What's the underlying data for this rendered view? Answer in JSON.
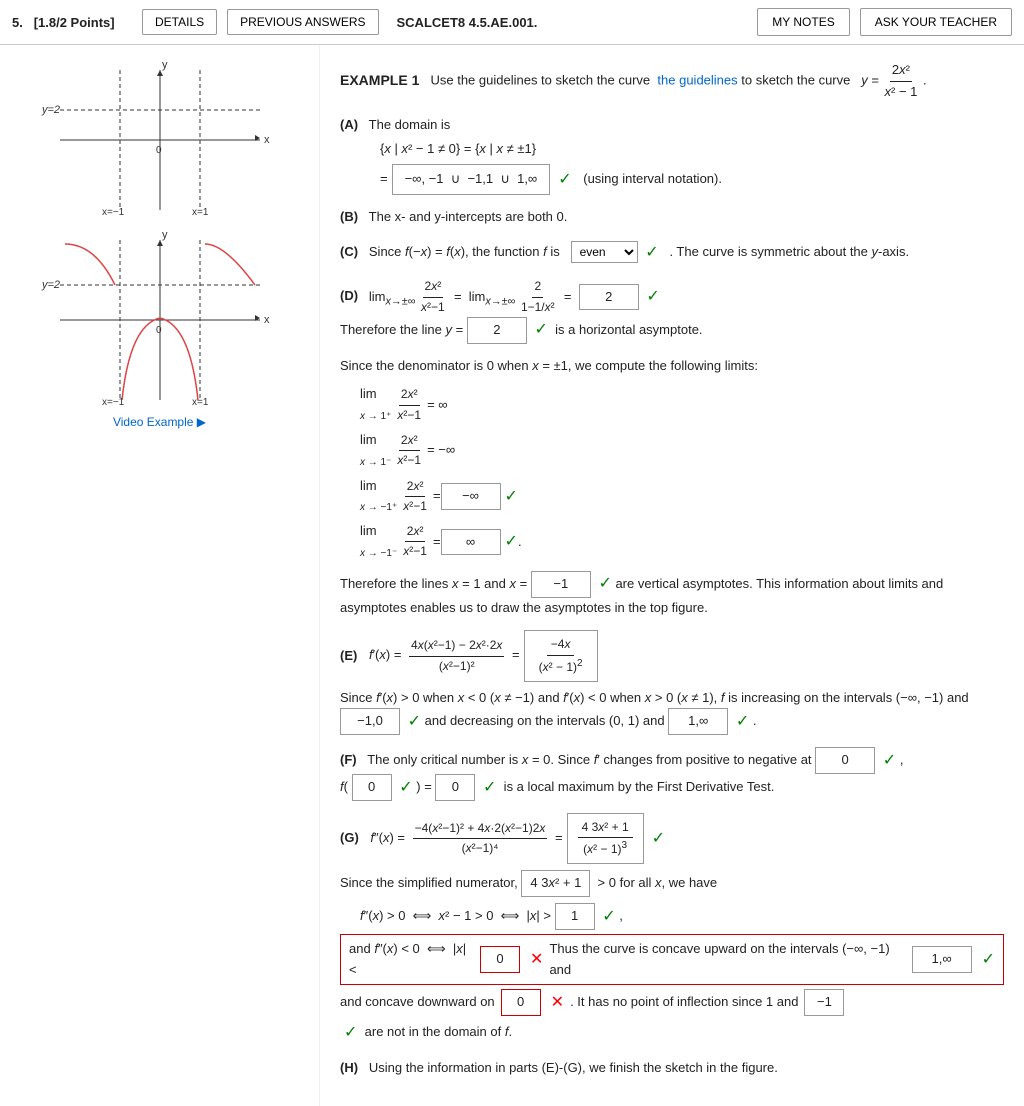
{
  "header": {
    "question_num": "5.",
    "points": "[1.8/2 Points]",
    "details_btn": "DETAILS",
    "prev_answers_btn": "PREVIOUS ANSWERS",
    "scalcet_label": "SCALCET8 4.5.AE.001.",
    "my_notes_btn": "MY NOTES",
    "ask_teacher_btn": "ASK YOUR TEACHER"
  },
  "example": {
    "title": "EXAMPLE 1",
    "intro": "Use the guidelines to sketch the curve",
    "function": "y = 2x² / (x² − 1)",
    "parts": {
      "A": {
        "label": "(A)",
        "text": "The domain is",
        "set": "{x | x² − 1 ≠ 0} = {x | x ≠ ±1}",
        "equals_sign": "=",
        "domain_interval": "−∞, −1  ∪  −1,1  ∪  1,∞",
        "note": "(using interval notation)."
      },
      "B": {
        "label": "(B)",
        "text": "The x- and y-intercepts are both 0."
      },
      "C": {
        "label": "(C)",
        "text_before": "Since f(−x) = f(x), the function f is",
        "select_value": "even",
        "text_after": ". The curve is symmetric about the y-axis."
      },
      "D": {
        "label": "(D)",
        "limit_expr": "lim x→±∞  2x²/(x²−1)  =  lim x→±∞  2/(1−1/x²)  =",
        "answer": "2",
        "text": "Therefore the line y =",
        "y_value": "2",
        "text2": "is a horizontal asymptote."
      },
      "vertical_asymptotes": {
        "text_before": "Since the denominator is 0 when x = ±1, we compute the following limits:",
        "lim1": {
          "sub": "x → 1⁺",
          "expr": "2x²/(x²−1)",
          "result": "= ∞"
        },
        "lim2": {
          "sub": "x → 1⁻",
          "expr": "2x²/(x²−1)",
          "result": "= −∞"
        },
        "lim3": {
          "sub": "x → −1⁺",
          "expr": "2x²/(x²−1)",
          "result": "−∞",
          "answer_shown": true
        },
        "lim4": {
          "sub": "x → −1⁻",
          "expr": "2x²/(x²−1)",
          "result": "∞",
          "answer_shown": true
        },
        "text_after": "Therefore the lines x = 1 and x =",
        "x_answer": "−1",
        "text_final": "are vertical asymptotes. This information about limits and asymptotes enables us to draw the asymptotes in the top figure."
      },
      "E": {
        "label": "(E)",
        "fprime_expr": "f′(x) = [4x(x²−1) − 2x²·2x] / (x²−1)²  =",
        "fprime_box_num": "−4x",
        "fprime_box_den": "x² − 1",
        "fprime_power": "2",
        "text_increasing": "Since f′(x) > 0 when x < 0 (x ≠ −1) and f′(x) < 0 when x > 0 (x ≠ 1), f is increasing on the intervals (−∞, −1)",
        "and_text": "and",
        "increasing_box": "−1,0",
        "decreasing_text": "and decreasing on the intervals (0, 1) and",
        "decreasing_box": "1,∞"
      },
      "F": {
        "label": "(F)",
        "text": "The only critical number is x = 0.  Since f′ changes from positive to negative at",
        "critical_box": "0",
        "fparen": "f(",
        "f_input": "0",
        "equals": "=",
        "f_value": "0",
        "text2": "is a local maximum by the First Derivative Test."
      },
      "G": {
        "label": "(G)",
        "fdprime_expr": "f″(x) = [−4(x²−1)² + 4x·2(x²−1)2x] / (x²−1)⁴  =",
        "fdprime_box_num": "4  3x² + 1",
        "fdprime_box_den": "x² − 1",
        "fdprime_power": "3",
        "numerator_display": "4  3x² + 1",
        "text_simplified": "Since the simplified numerator,",
        "positive_text": "> 0 for all x, we have",
        "concave_condition1": "f″(x) > 0  ⟺  x² − 1 > 0  ⟺  |x| >",
        "concave_ans1": "1",
        "concave_condition2_text": "and f″(x) < 0  ⟺  |x| <",
        "concave_ans2": "0",
        "concave_condition2_error": true,
        "concave_text": "Thus the curve is concave upward on the intervals (−∞, −1) and",
        "concave_up_box": "1,∞",
        "concave_down_text": "and concave downward on",
        "concave_down_input": "0",
        "concave_down_error": true,
        "inflection_text": ". It has no point of inflection since 1 and",
        "inflection_box": "−1",
        "not_in_domain": "are not in the domain of f."
      },
      "H": {
        "label": "(H)",
        "text": "Using the information in parts (E)-(G), we finish the sketch in the figure."
      }
    }
  },
  "video_link": "Video Example"
}
